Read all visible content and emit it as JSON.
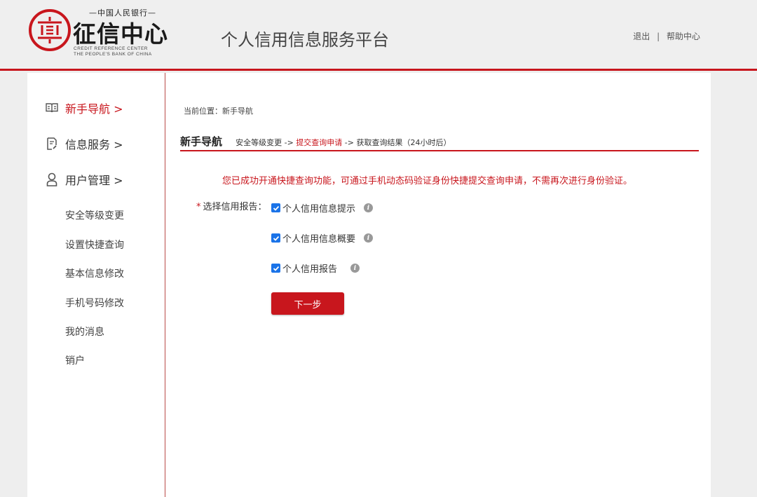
{
  "header": {
    "logo": {
      "top_text": "—中国人民银行—",
      "main_text": "征信中心",
      "en_line1": "CREDIT REFERENCE CENTER",
      "en_line2": "THE PEOPLE'S BANK OF CHINA"
    },
    "platform_title": "个人信用信息服务平台",
    "links": {
      "logout": "退出",
      "separator": "|",
      "help": "帮助中心"
    }
  },
  "sidebar": {
    "nav": [
      {
        "label": "新手导航 >",
        "icon": "book-icon",
        "active": true
      },
      {
        "label": "信息服务 >",
        "icon": "document-icon",
        "active": false
      },
      {
        "label": "用户管理 >",
        "icon": "user-icon",
        "active": false
      }
    ],
    "sub_items": [
      "安全等级变更",
      "设置快捷查询",
      "基本信息修改",
      "手机号码修改",
      "我的消息",
      "销户"
    ]
  },
  "main": {
    "breadcrumb": "当前位置：新手导航",
    "section_title": "新手导航",
    "steps": {
      "step1": "安全等级变更 ->",
      "step2": "提交查询申请",
      "step3": "-> 获取查询结果（24小时后）"
    },
    "notice": "您已成功开通快捷查询功能，可通过手机动态码验证身份快捷提交查询申请，不需再次进行身份验证。",
    "form": {
      "required_mark": "*",
      "label": "选择信用报告：",
      "options": [
        {
          "label": "个人信用信息提示",
          "checked": true
        },
        {
          "label": "个人信用信息概要",
          "checked": true
        },
        {
          "label": "个人信用报告",
          "checked": true
        }
      ],
      "next_button": "下一步"
    }
  },
  "colors": {
    "accent": "#c8161d",
    "checkbox": "#1a73e8",
    "background": "#eeeeee"
  }
}
